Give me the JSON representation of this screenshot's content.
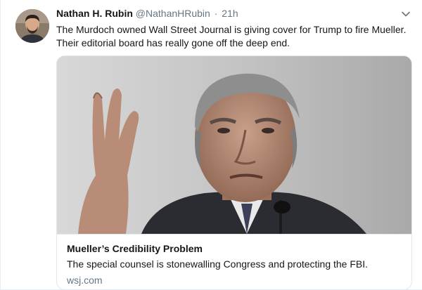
{
  "tweet": {
    "author_name": "Nathan H. Rubin",
    "author_handle": "@NathanHRubin",
    "separator": "·",
    "timestamp": "21h",
    "text_line1": "The Murdoch owned Wall Street Journal is giving cover for Trump to fire Mueller.",
    "text_line2": "Their editorial board has really gone off the deep end."
  },
  "card": {
    "title": "Mueller’s Credibility Problem",
    "description": "The special counsel is stonewalling Congress and protecting the FBI.",
    "domain": "wsj.com"
  },
  "icons": {
    "menu": "chevron-down-icon"
  },
  "colors": {
    "text_primary": "#14171a",
    "text_secondary": "#657786",
    "border": "#e1e8ed",
    "page_background": "#e6ecf0"
  }
}
